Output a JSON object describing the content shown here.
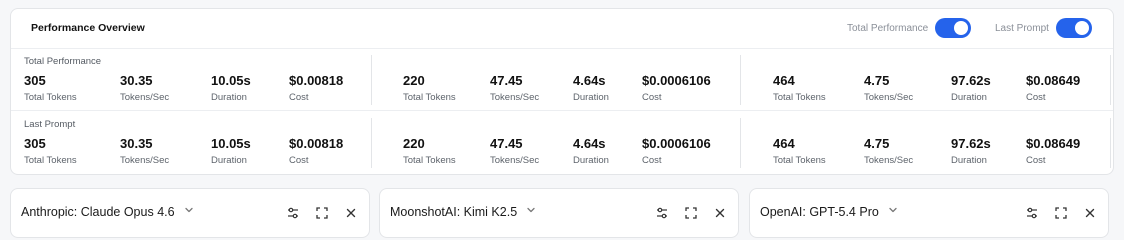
{
  "panel": {
    "title": "Performance Overview",
    "toggles": {
      "total_performance": {
        "label": "Total Performance",
        "on": true
      },
      "last_prompt": {
        "label": "Last Prompt",
        "on": true
      }
    },
    "accent_color": "#2563eb",
    "rows": {
      "total": {
        "label": "Total Performance",
        "groups": [
          {
            "tokens": "305",
            "tokens_per_sec": "30.35",
            "duration": "10.05s",
            "cost": "$0.00818"
          },
          {
            "tokens": "220",
            "tokens_per_sec": "47.45",
            "duration": "4.64s",
            "cost": "$0.0006106"
          },
          {
            "tokens": "464",
            "tokens_per_sec": "4.75",
            "duration": "97.62s",
            "cost": "$0.08649"
          }
        ]
      },
      "last": {
        "label": "Last Prompt",
        "groups": [
          {
            "tokens": "305",
            "tokens_per_sec": "30.35",
            "duration": "10.05s",
            "cost": "$0.00818"
          },
          {
            "tokens": "220",
            "tokens_per_sec": "47.45",
            "duration": "4.64s",
            "cost": "$0.0006106"
          },
          {
            "tokens": "464",
            "tokens_per_sec": "4.75",
            "duration": "97.62s",
            "cost": "$0.08649"
          }
        ]
      }
    },
    "metric_labels": {
      "tokens": "Total Tokens",
      "tokens_per_sec": "Tokens/Sec",
      "duration": "Duration",
      "cost": "Cost"
    }
  },
  "models": [
    {
      "name": "Anthropic: Claude Opus 4.6",
      "icons": [
        "sliders-icon",
        "expand-icon",
        "close-icon"
      ]
    },
    {
      "name": "MoonshotAI: Kimi K2.5",
      "icons": [
        "sliders-icon",
        "expand-icon",
        "close-icon"
      ]
    },
    {
      "name": "OpenAI: GPT-5.4 Pro",
      "icons": [
        "sliders-icon",
        "expand-icon",
        "close-icon"
      ]
    }
  ]
}
